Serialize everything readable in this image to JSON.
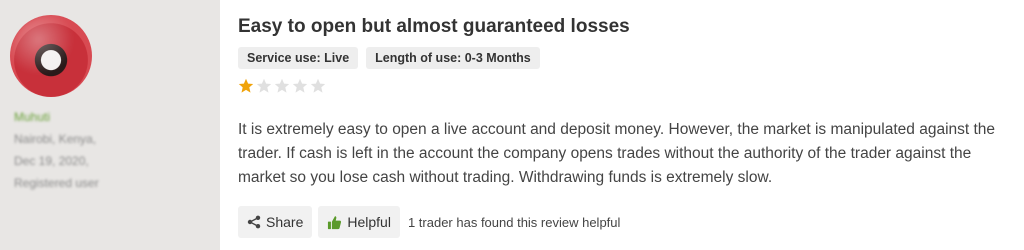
{
  "author": {
    "name": "Muhuti",
    "location": "Nairobi, Kenya,",
    "date": "Dec 19, 2020,",
    "status": "Registered user"
  },
  "review": {
    "title": "Easy to open but almost guaranteed losses",
    "badges": {
      "service_use": "Service use: Live",
      "length_of_use": "Length of use: 0-3 Months"
    },
    "rating": {
      "value": 1,
      "max": 5
    },
    "body": "It is extremely easy to open a live account and deposit money. However, the market is manipulated against the trader. If cash is left in the account the company opens trades without the authority of the trader against the market so you lose cash without trading. Withdrawing funds is extremely slow."
  },
  "actions": {
    "share_label": "Share",
    "helpful_label": "Helpful",
    "helpful_count_text": "1 trader has found this review helpful"
  },
  "colors": {
    "sidebar_bg": "#e8e6e4",
    "star_filled": "#f0a30a",
    "star_empty": "#e0e0e0",
    "author_name": "#6aa23a",
    "helpful_icon": "#5a9a2a"
  }
}
